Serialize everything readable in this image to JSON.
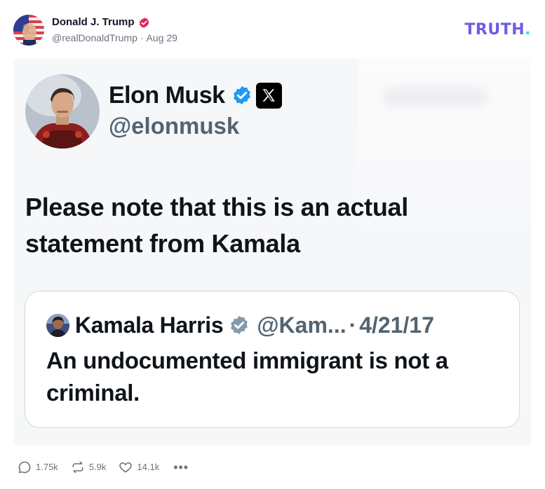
{
  "post": {
    "author_name": "Donald J. Trump",
    "handle": "@realDonaldTrump",
    "separator": "·",
    "date": "Aug 29",
    "avatar_icon": "trump-flag-avatar",
    "verified_color": "#e0245e"
  },
  "brand": {
    "logo_text": "TRUTH",
    "logo_dot": ".",
    "logo_color": "#6c5ce7",
    "dot_color": "#2ee6c9"
  },
  "embedded_tweet": {
    "author_name": "Elon Musk",
    "handle": "@elonmusk",
    "verified_color": "#1d9bf0",
    "platform_icon": "x-logo-icon",
    "text": "Please note that this is an actual statement from Kamala",
    "quote": {
      "author_name": "Kamala Harris",
      "handle": "@Kam...",
      "separator": "·",
      "date": "4/21/17",
      "verified_color": "#829aab",
      "text": "An undocumented immigrant is not a criminal."
    }
  },
  "actions": {
    "replies": "1.75k",
    "retruths": "5.9k",
    "likes": "14.1k",
    "more": "•••"
  }
}
